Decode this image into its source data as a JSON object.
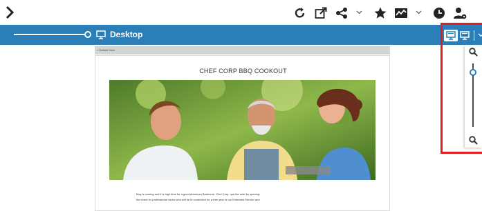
{
  "toolbar": {
    "nav_icon": "chevron-right-icon",
    "icons": [
      "refresh-icon",
      "open-external-icon",
      "share-icon",
      "star-icon",
      "analytics-icon",
      "schedule-icon",
      "user-settings-icon"
    ]
  },
  "viewbar": {
    "device_label": "Desktop",
    "device_icon": "desktop-icon",
    "width_slider_level": 1.0
  },
  "canvas": {
    "view_label": "< Default View",
    "title": "CHEF CORP BBQ COOKOUT",
    "body_lines": [
      "May is coming and it is high time for a good American Barbecue. Chef Corp. ups the ante by opening",
      "the event for professional cooks who will be in contention for a free year of our Extended Service and"
    ]
  },
  "zoom": {
    "level_fraction": 0.1,
    "zoom_in_icon": "zoom-in-icon",
    "zoom_out_icon": "zoom-out-icon"
  },
  "colors": {
    "accent": "#2a7fb8",
    "highlight": "#e02020"
  }
}
